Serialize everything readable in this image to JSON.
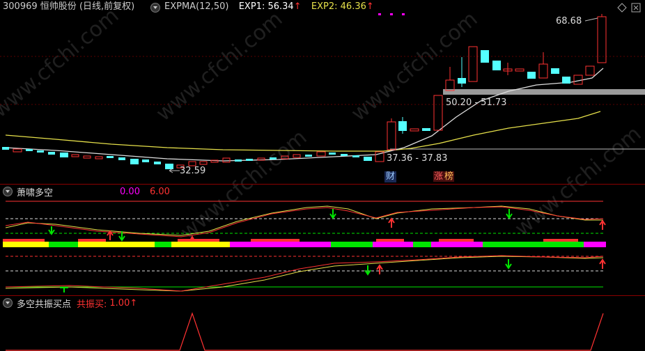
{
  "header": {
    "code": "300969",
    "name": "恒帅股份",
    "period": "(日线,前复权)",
    "indicator": "EXPMA(12,50)",
    "exp1_label": "EXP1:",
    "exp1_value": "56.34",
    "exp2_label": "EXP2:",
    "exp2_value": "46.36",
    "arrow": "↑"
  },
  "main_chart": {
    "high_label": "68.68",
    "range_label_1": "50.20 - 51.73",
    "range_label_2": "37.36 - 37.83",
    "low_label": "32.59",
    "badge_finance": "财",
    "badge_limit_up_1": "涨",
    "badge_limit_up_2": "榜"
  },
  "panel2": {
    "title": "萧啸多空",
    "value1": "0.00",
    "value2": "6.00"
  },
  "panel3": {
    "title": "多空共振买点",
    "label": "共振买:",
    "value": "1.00",
    "arrow": "↑"
  },
  "watermark": "www.cfchi.com",
  "colors": {
    "up": "#ff3232",
    "down": "#54ffff",
    "exp1": "#ffffff",
    "exp2": "#e6e04a",
    "magenta": "#ff00ff",
    "green": "#00e600",
    "yellow": "#ffff00"
  }
}
